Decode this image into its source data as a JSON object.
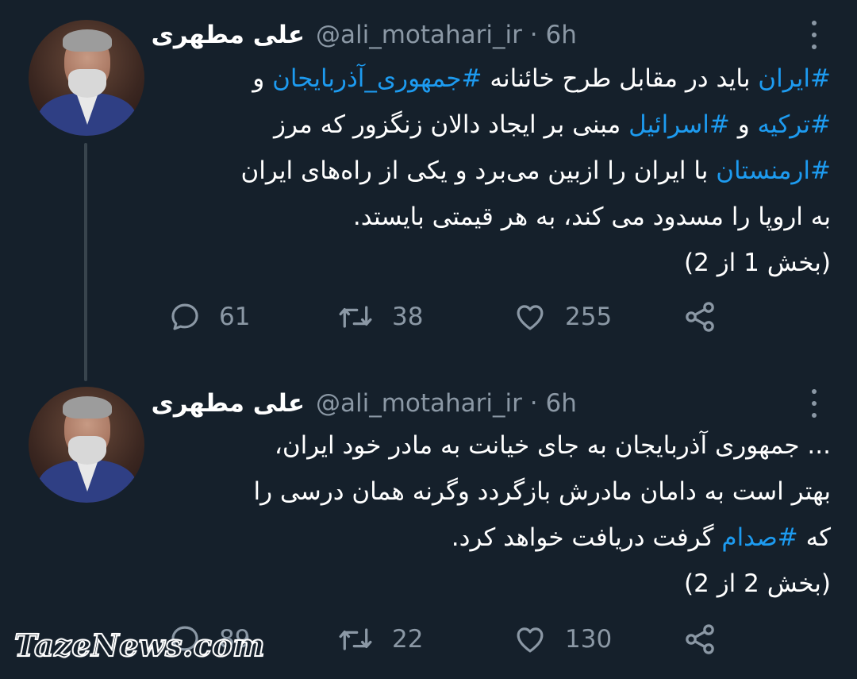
{
  "tweets": [
    {
      "display_name": "علی مطهری",
      "handle": "@ali_motahari_ir",
      "separator": "·",
      "time": "6h",
      "lines": [
        [
          {
            "t": "#ایران",
            "tag": true
          },
          {
            "t": " باید در مقابل طرح خائنانه "
          },
          {
            "t": "#جمهوری_آذربایجان",
            "tag": true
          },
          {
            "t": " و"
          }
        ],
        [
          {
            "t": "#ترکیه",
            "tag": true
          },
          {
            "t": " و "
          },
          {
            "t": "#اسرائیل",
            "tag": true
          },
          {
            "t": " مبنی بر ایجاد دالان زنگزور که مرز"
          }
        ],
        [
          {
            "t": "#ارمنستان",
            "tag": true
          },
          {
            "t": " با ایران را ازبین می‌برد و یکی از راه‌های ایران"
          }
        ],
        [
          {
            "t": "به اروپا را مسدود می کند، به هر قیمتی بایستد."
          }
        ],
        [
          {
            "t": "(بخش 1 از 2)"
          }
        ]
      ],
      "replies": "61",
      "retweets": "38",
      "likes": "255"
    },
    {
      "display_name": "علی مطهری",
      "handle": "@ali_motahari_ir",
      "separator": "·",
      "time": "6h",
      "lines": [
        [
          {
            "t": "... جمهوری آذربایجان به جای خیانت به مادر خود ایران،"
          }
        ],
        [
          {
            "t": "بهتر است به دامان مادرش بازگردد وگرنه همان درسی را"
          }
        ],
        [
          {
            "t": "که "
          },
          {
            "t": "#صدام",
            "tag": true
          },
          {
            "t": " گرفت دریافت خواهد کرد."
          }
        ],
        [
          {
            "t": "(بخش 2 از 2)"
          }
        ]
      ],
      "replies": "89",
      "retweets": "22",
      "likes": "130"
    }
  ],
  "watermark": "TazeNews.com",
  "colors": {
    "background": "#15202b",
    "text": "#ffffff",
    "secondary": "#8b98a5",
    "hashtag": "#1d9bf0",
    "thread_line": "#38444d"
  },
  "icons": [
    "reply-icon",
    "retweet-icon",
    "like-icon",
    "share-icon",
    "more-icon"
  ]
}
